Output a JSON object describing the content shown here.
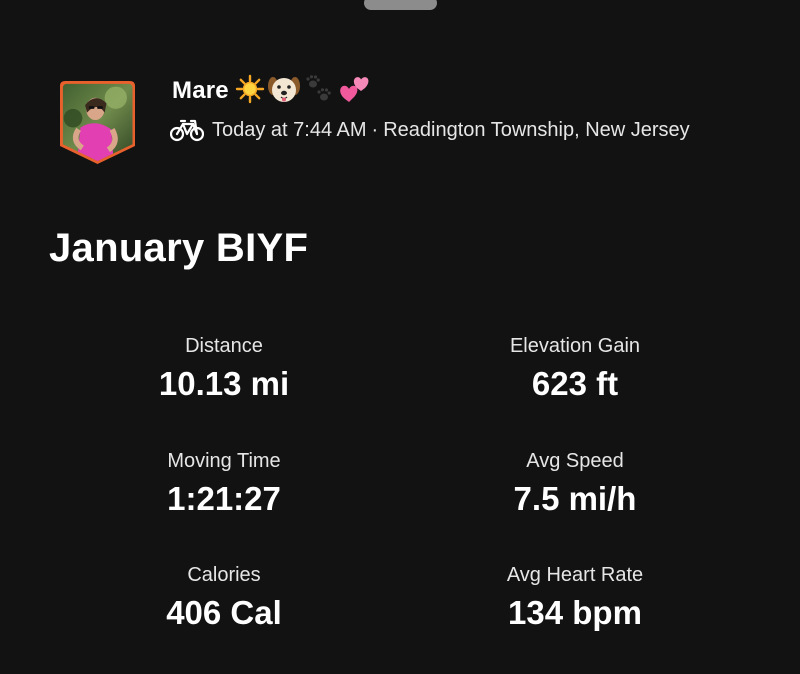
{
  "athlete": {
    "name": "Mare",
    "name_emojis": [
      "sun-icon",
      "puppy-face-icon",
      "paw-prints-icon",
      "two-hearts-icon"
    ]
  },
  "activity": {
    "type_icon": "bicycle-icon",
    "time": "Today at 7:44 AM",
    "separator": "·",
    "location": "Readington Township, New Jersey",
    "title": "January BIYF"
  },
  "stats": [
    {
      "label": "Distance",
      "value": "10.13 mi"
    },
    {
      "label": "Elevation Gain",
      "value": "623 ft"
    },
    {
      "label": "Moving Time",
      "value": "1:21:27"
    },
    {
      "label": "Avg Speed",
      "value": "7.5 mi/h"
    },
    {
      "label": "Calories",
      "value": "406 Cal"
    },
    {
      "label": "Avg Heart Rate",
      "value": "134 bpm"
    }
  ],
  "colors": {
    "background": "#121212",
    "text": "#ffffff",
    "secondary_text": "#e6e6e6",
    "avatar_border": "#e8612c",
    "handle": "#8c8c8c"
  }
}
